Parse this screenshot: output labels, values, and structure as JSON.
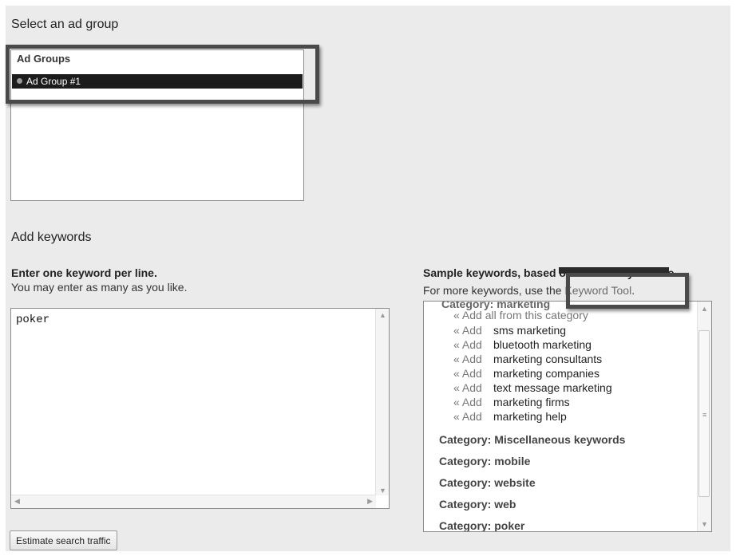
{
  "select_title": "Select an ad group",
  "ad_groups": {
    "header": "Ad Groups",
    "items": [
      "Ad Group #1"
    ]
  },
  "add_keywords_title": "Add keywords",
  "enter": {
    "bold": "Enter one keyword per line.",
    "hint": "You may enter as many as you like.",
    "value": "poker"
  },
  "sample": {
    "title_start": "Sample keywords, bas",
    "title_obscured": "ed on a scan of you",
    "title_end": "r site",
    "more_prefix": "For more keywords, use t",
    "more_obscured": "he",
    "more_link": "Keyword Tool",
    "more_suffix": ".",
    "top_category": "Category: marketing",
    "add_all": "« Add all from this category",
    "add_label": "« Add",
    "keywords": [
      "sms marketing",
      "bluetooth marketing",
      "marketing consultants",
      "marketing companies",
      "text message marketing",
      "marketing firms",
      "marketing help"
    ],
    "category_label": "Category:",
    "categories": [
      "Miscellaneous keywords",
      "mobile",
      "website",
      "web",
      "poker"
    ]
  },
  "estimate_button": "Estimate search traffic",
  "colors": {
    "panel": "#ebebeb",
    "selected_row": "#1c1c1c",
    "highlight_border": "#4a4a4a"
  }
}
